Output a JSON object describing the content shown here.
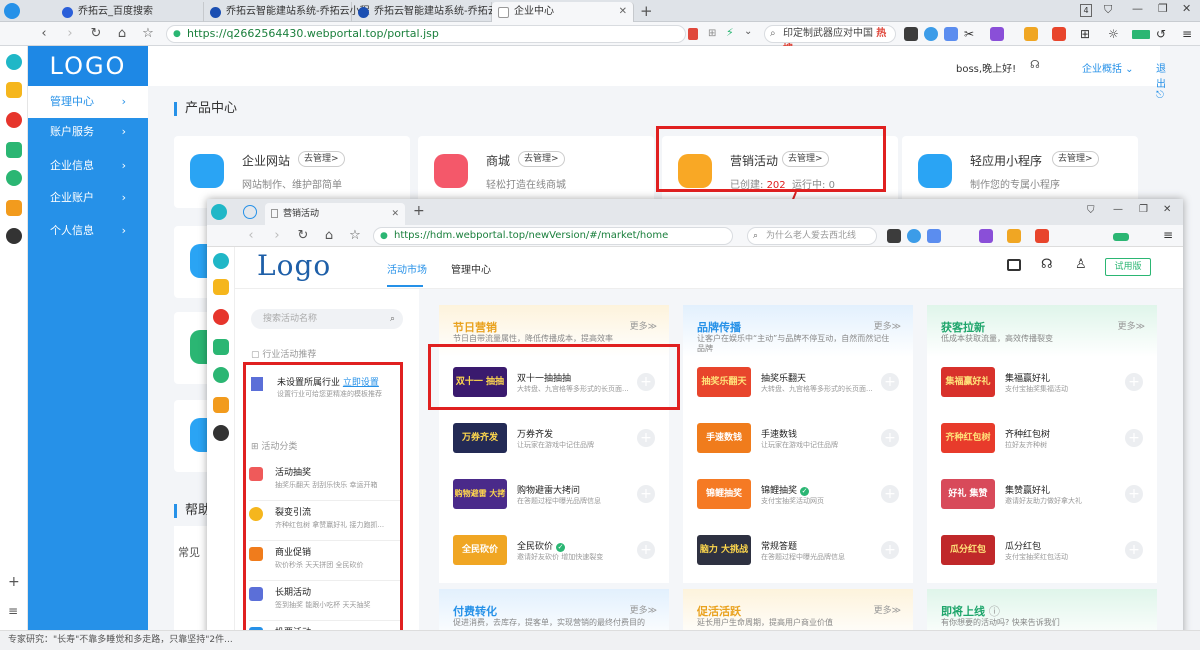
{
  "outer_tabs": [
    {
      "label": "乔拓云_百度搜索"
    },
    {
      "label": "乔拓云智能建站系统-乔拓云小程"
    },
    {
      "label": "乔拓云智能建站系统-乔拓云小程"
    },
    {
      "label": "企业中心"
    }
  ],
  "outer_tab_count": "4",
  "outer_address": {
    "scheme": "https://",
    "url": "q2662564430.webportal.top/portal.jsp"
  },
  "outer_search": {
    "text": "印定制武器应对中国",
    "hot": "热搜"
  },
  "portal": {
    "logo": "LOGO",
    "sidebar": [
      {
        "label": "管理中心"
      },
      {
        "label": "账户服务"
      },
      {
        "label": "企业信息"
      },
      {
        "label": "企业账户"
      },
      {
        "label": "个人信息"
      }
    ],
    "greeting": "boss,晚上好!",
    "overview": "企业概括",
    "logout": "退出",
    "section_title": "产品中心",
    "help_title": "帮助",
    "help_sub": "常见",
    "manage_label": "去管理>",
    "products": [
      {
        "title": "企业网站",
        "desc": "网站制作、维护部简单"
      },
      {
        "title": "商城",
        "desc": "轻松打造在线商城"
      },
      {
        "title": "营销活动",
        "created_label": "已创建:",
        "created": "202",
        "running_label": "运行中:",
        "running": "0"
      },
      {
        "title": "轻应用小程序",
        "desc": "制作您的专属小程序"
      }
    ]
  },
  "inner": {
    "tab_title": "营销活动",
    "address": {
      "scheme": "https://",
      "url": "hdm.webportal.top/newVersion/#/market/home"
    },
    "search_placeholder": "为什么老人爱去西北线",
    "logo": "Logo",
    "nav": [
      {
        "label": "活动市场"
      },
      {
        "label": "管理中心"
      }
    ],
    "try_button": "试用版",
    "search_placeholder_left": "搜索活动名称",
    "industry_label": "行业活动推荐",
    "industry_title": "未设置所属行业",
    "industry_link": "立即设置",
    "industry_desc": "设置行业可给您更精准的模板推荐",
    "category_label": "活动分类",
    "categories": [
      {
        "name": "活动抽奖",
        "desc": "抽奖乐翻天   刮刮乐快乐   幸运开箱"
      },
      {
        "name": "裂变引流",
        "desc": "齐种红包树   拿赞赢好礼   接力跑抓..."
      },
      {
        "name": "商业促销",
        "desc": "砍价秒杀   天天拼团   全民砍价"
      },
      {
        "name": "长期活动",
        "desc": "签到抽奖   能跟小吃杯   天天抽奖"
      },
      {
        "name": "投票活动",
        "desc": ""
      }
    ],
    "more": "更多≫",
    "columns": [
      {
        "title": "节日营销",
        "color": "#e9a21f",
        "sub": "节日自带流量属性，降低传播成本，提高效率",
        "items": [
          {
            "name": "双十一抽抽抽",
            "desc": "大转盘、九宫格等多形式的长页面...",
            "thumb": "双十一 抽抽抽",
            "bg": "#3a1a6e"
          },
          {
            "name": "万券齐发",
            "desc": "让玩家在游戏中记住品牌",
            "thumb": "万券齐发",
            "bg": "#232a55"
          },
          {
            "name": "购物避雷大拷问",
            "desc": "在答题过程中曝光品牌信息",
            "thumb": "购物避雷 大拷问",
            "bg": "#4a2a8a"
          },
          {
            "name": "全民砍价",
            "desc": "邀请好友砍价 增加快速裂变",
            "thumb": "全民砍价",
            "bg": "#f0a623",
            "ok": "✓"
          }
        ]
      },
      {
        "title": "品牌传播",
        "color": "#2691e8",
        "sub": "让客户在娱乐中“主动”与品牌不停互动，自然而然记住品牌",
        "items": [
          {
            "name": "抽奖乐翻天",
            "desc": "大转盘、九宫格等多形式的长页面...",
            "thumb": "抽奖乐翻天",
            "bg": "#e8452c"
          },
          {
            "name": "手速数钱",
            "desc": "让玩家在游戏中记住品牌",
            "thumb": "手速数钱",
            "bg": "#f07c1c"
          },
          {
            "name": "锦鲤抽奖",
            "desc": "支付宝抽奖活动网页",
            "thumb": "锦鲤抽奖",
            "bg": "#f57a24",
            "ok": "✓"
          },
          {
            "name": "常规答题",
            "desc": "在答题过程中曝光品牌信息",
            "thumb": "脑力 大挑战",
            "bg": "#2e3141"
          }
        ]
      },
      {
        "title": "获客拉新",
        "color": "#1ea56b",
        "sub": "低成本获取流量，高效传播裂变",
        "items": [
          {
            "name": "集福赢好礼",
            "desc": "支付宝抽奖集福活动",
            "thumb": "集福赢好礼",
            "bg": "#d8312b"
          },
          {
            "name": "齐种红包树",
            "desc": "拉好友齐种树",
            "thumb": "齐种红包树",
            "bg": "#e83b2b"
          },
          {
            "name": "集赞赢好礼",
            "desc": "邀请好友助力做好拿大礼",
            "thumb": "好礼 集赞",
            "bg": "#d84a5a"
          },
          {
            "name": "瓜分红包",
            "desc": "支付宝抽奖红包活动",
            "thumb": "瓜分红包",
            "bg": "#c0282a"
          }
        ]
      }
    ],
    "bottom_columns": [
      {
        "title": "付费转化",
        "color": "#2691e8",
        "sub": "促进消费，去库存，提客单，实现营销的最终付费目的"
      },
      {
        "title": "促活活跃",
        "color": "#e9a21f",
        "sub": "延长用户生命周期，提高用户商业价值"
      },
      {
        "title": "即将上线",
        "color": "#1ea56b",
        "sub": "有你想要的活动吗? 快来告诉我们"
      }
    ]
  },
  "statusbar": "专家研究：\"长寿\"不靠多睡觉和多走路，只靠坚持\"2件..."
}
